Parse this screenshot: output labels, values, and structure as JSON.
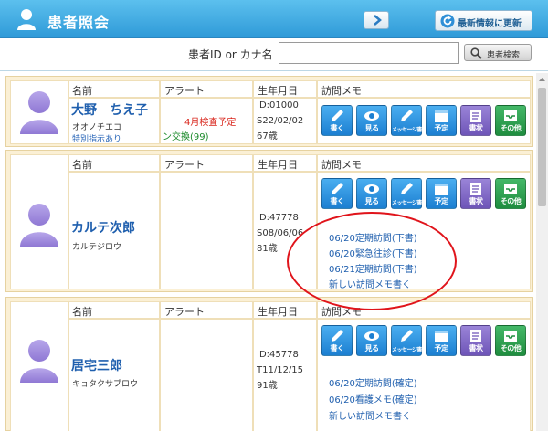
{
  "header": {
    "title": "患者照会",
    "refresh_label": "最新情報に更新"
  },
  "search": {
    "label": "患者ID or カナ名",
    "value": "",
    "placeholder": "",
    "button_label": "患者検索"
  },
  "columns": {
    "name": "名前",
    "alert": "アラート",
    "birth": "生年月日",
    "memo": "訪問メモ"
  },
  "actions": [
    {
      "label": "書く",
      "icon": "pencil-icon",
      "color": "blue"
    },
    {
      "label": "見る",
      "icon": "eye-icon",
      "color": "blue"
    },
    {
      "label": "メッセージ書く",
      "icon": "message-pencil-icon",
      "color": "blue"
    },
    {
      "label": "予定",
      "icon": "calendar-icon",
      "color": "blue"
    },
    {
      "label": "書状",
      "icon": "document-icon",
      "color": "purple"
    },
    {
      "label": "その他",
      "icon": "tray-icon",
      "color": "green"
    }
  ],
  "patients": [
    {
      "name": "大野　ちえ子",
      "kana": "オオノチエコ",
      "special": "特別指示あり",
      "alerts": [
        "4月検査予定",
        "ン交換(99)"
      ],
      "id": "ID:01000",
      "birth": "S22/02/02",
      "age": "67歳",
      "memos": []
    },
    {
      "name": "カルテ次郎",
      "kana": "カルテジロウ",
      "special": "",
      "alerts": [],
      "id": "ID:47778",
      "birth": "S08/06/06",
      "age": "81歳",
      "memos": [
        "06/20定期訪問(下書)",
        "06/20緊急往診(下書)",
        "06/21定期訪問(下書)",
        "新しい訪問メモ書く"
      ]
    },
    {
      "name": "居宅三郎",
      "kana": "キョタクサブロウ",
      "special": "",
      "alerts": [],
      "id": "ID:45778",
      "birth": "T11/12/15",
      "age": "91歳",
      "memos": [
        "06/20定期訪問(確定)",
        "06/20看護メモ(確定)",
        "新しい訪問メモ書く"
      ]
    }
  ],
  "colors": {
    "header": "#2f9ad8",
    "card_bg": "#fbf0d5",
    "link": "#1f5fae",
    "alert": "#d9261c",
    "annotation": "#e0141b"
  }
}
